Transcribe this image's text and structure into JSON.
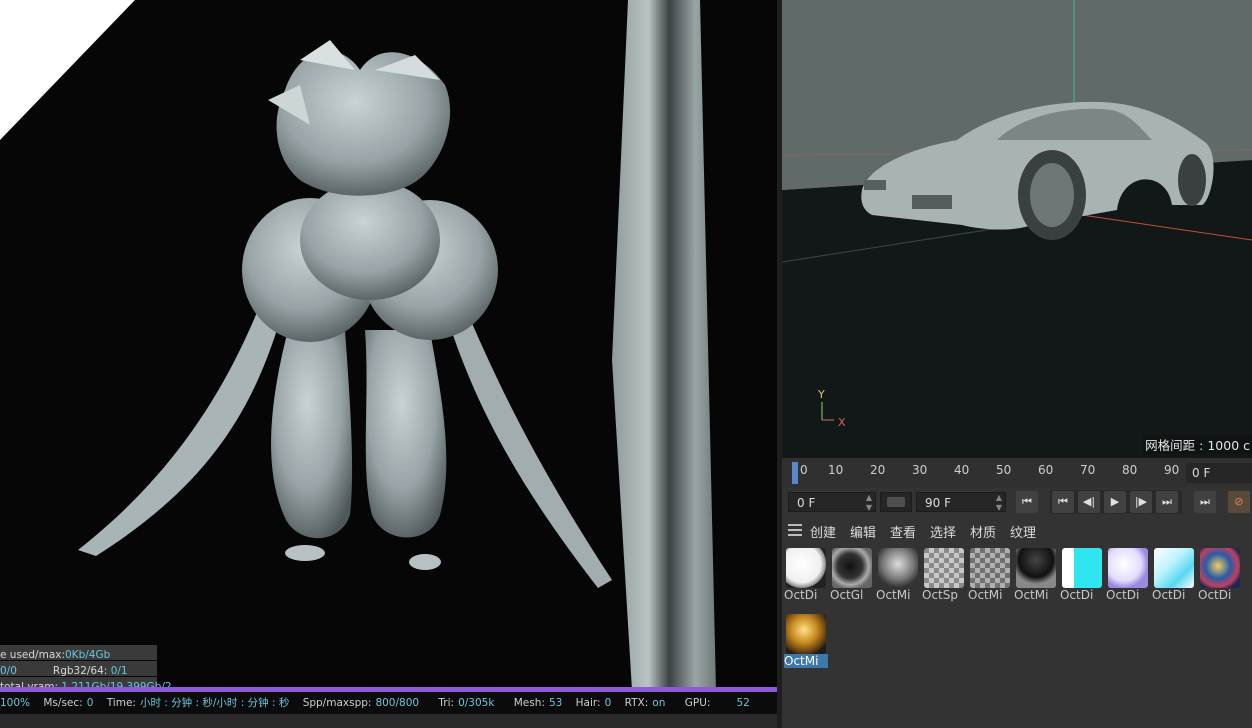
{
  "viewer": {
    "stats_line1_label": "e used/max:",
    "stats_line1_value": "0Kb/4Gb",
    "stats_line2_value": "0/0",
    "stats_line2_label": "Rgb32/64:",
    "stats_line2_value2": "0/1",
    "stats_line3_label": "total vram:",
    "stats_line3_value": "1.211Gb/19.399Gb/2",
    "render_progress_percent": 100
  },
  "statusbar": {
    "percent": "100%",
    "ms_label": "Ms/sec:",
    "ms_value": "0",
    "time_label": "Time:",
    "time_value": "小时 : 分钟 : 秒/小时 : 分钟 : 秒",
    "spp_label": "Spp/maxspp:",
    "spp_value": "800/800",
    "tri_label": "Tri:",
    "tri_value": "0/305k",
    "mesh_label": "Mesh:",
    "mesh_value": "53",
    "hair_label": "Hair:",
    "hair_value": "0",
    "rtx_label": "RTX:",
    "rtx_value": "on",
    "gpu_label": "GPU:",
    "gpu_value": "52"
  },
  "viewport": {
    "grid_label": "网格间距 : 1000 c",
    "axis_y": "Y",
    "axis_x": "X"
  },
  "timeline": {
    "ticks": [
      "0",
      "10",
      "20",
      "30",
      "40",
      "50",
      "60",
      "70",
      "80",
      "90"
    ],
    "current_frame": "0 F"
  },
  "transport": {
    "start_frame": "0 F",
    "end_frame": "90 F",
    "buttons": [
      "go-start",
      "go-start-alt",
      "step-back",
      "play",
      "step-forward",
      "go-end",
      "record"
    ]
  },
  "material_menu": {
    "items": [
      "创建",
      "编辑",
      "查看",
      "选择",
      "材质",
      "纹理"
    ]
  },
  "materials": [
    {
      "label": "OctDi",
      "kind": "white"
    },
    {
      "label": "OctGl",
      "kind": "dark-glossy"
    },
    {
      "label": "OctMi",
      "kind": "checker-dark"
    },
    {
      "label": "OctSp",
      "kind": "checker-light"
    },
    {
      "label": "OctMi",
      "kind": "checker-gray"
    },
    {
      "label": "OctMi",
      "kind": "dark-checker"
    },
    {
      "label": "OctDi",
      "kind": "cyan"
    },
    {
      "label": "OctDi",
      "kind": "lavender"
    },
    {
      "label": "OctDi",
      "kind": "cyan-pattern"
    },
    {
      "label": "OctDi",
      "kind": "colorful"
    },
    {
      "label": "OctMi",
      "kind": "gold"
    }
  ],
  "colors": {
    "accent_blue": "#5a87c9",
    "stat_value": "#69c8e0",
    "progress": "#8d5bd8",
    "selected": "#3d78a8"
  }
}
